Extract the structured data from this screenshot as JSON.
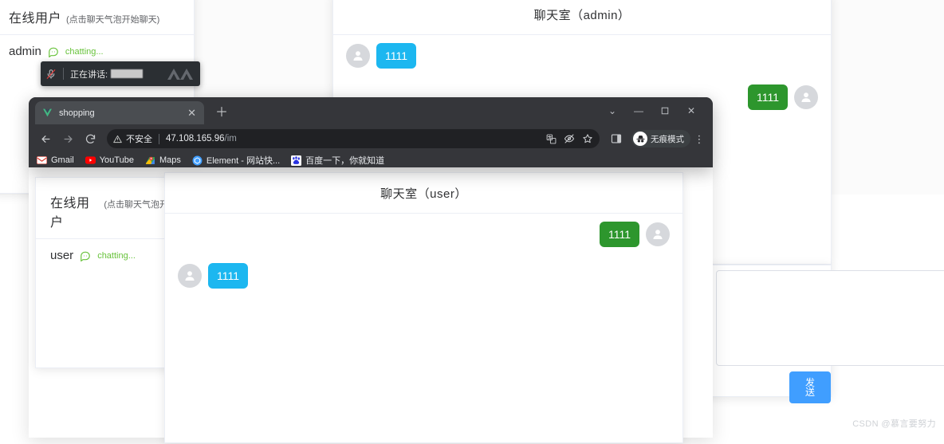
{
  "background_app": {
    "online_panel": {
      "title": "在线用户",
      "hint": "(点击聊天气泡开始聊天)",
      "user": "admin",
      "status": "chatting...",
      "chat_icon": "chat-bubble-icon"
    },
    "chatroom": {
      "title": "聊天室（admin）",
      "messages": [
        {
          "side": "left",
          "text": "1111",
          "color": "#1cb7f0",
          "avatar": "user-avatar-icon"
        },
        {
          "side": "right",
          "text": "1111",
          "color": "#2d962d",
          "avatar": "user-avatar-icon"
        }
      ]
    },
    "composer": {
      "send_label": "发送",
      "textarea_value": "",
      "resize_handle": "resize-grip-icon"
    }
  },
  "speaking_toast": {
    "mic_icon": "microphone-muted-icon",
    "label": "正在讲话:",
    "redacted_value": "",
    "brand_icon": "chevrons-logo-icon"
  },
  "browser": {
    "tab": {
      "title": "shopping",
      "favicon": "vue-logo-icon",
      "close_icon": "close-icon"
    },
    "new_tab_icon": "plus-icon",
    "window_controls": {
      "chevron": "chevron-down-icon",
      "minimize": "minimize-icon",
      "maximize": "maximize-icon",
      "close": "close-icon"
    },
    "nav": {
      "back_icon": "arrow-left-icon",
      "forward_icon": "arrow-right-icon",
      "reload_icon": "reload-icon"
    },
    "omnibox": {
      "warning_icon": "warning-triangle-icon",
      "warning_text": "不安全",
      "url_host": "47.108.165.96",
      "url_path": "/im",
      "actions": [
        {
          "name": "translate-icon",
          "glyph": "translate"
        },
        {
          "name": "eye-off-icon",
          "glyph": "eye-off"
        },
        {
          "name": "bookmark-star-icon",
          "glyph": "star"
        }
      ]
    },
    "side_panel_icon": "side-panel-icon",
    "incognito": {
      "label": "无痕模式",
      "icon": "incognito-hat-icon"
    },
    "menu_icon": "kebab-menu-icon",
    "bookmarks": [
      {
        "label": "Gmail",
        "icon": "gmail-icon",
        "color": "#d93025"
      },
      {
        "label": "YouTube",
        "icon": "youtube-icon",
        "color": "#ff0000"
      },
      {
        "label": "Maps",
        "icon": "google-maps-icon",
        "color": "#34a853"
      },
      {
        "label": "Element - 网站快...",
        "icon": "element-ui-icon",
        "color": "#409eff"
      },
      {
        "label": "百度一下，你就知道",
        "icon": "baidu-icon",
        "color": "#2932e1"
      }
    ]
  },
  "foreground_app": {
    "online_panel": {
      "title": "在线用户",
      "hint": "(点击聊天气泡开始聊",
      "user": "user",
      "status": "chatting...",
      "chat_icon": "chat-bubble-icon"
    },
    "chatroom": {
      "title": "聊天室（user）",
      "messages": [
        {
          "side": "right",
          "text": "1111",
          "color": "#2d962d",
          "avatar": "user-avatar-icon"
        },
        {
          "side": "left",
          "text": "1111",
          "color": "#1cb7f0",
          "avatar": "user-avatar-icon"
        }
      ]
    }
  },
  "watermark": "CSDN @慕言要努力",
  "theme": {
    "blue_bubble": "#1cb7f0",
    "green_bubble": "#2d962d",
    "primary_button": "#409eff",
    "status_green": "#67c23a",
    "chrome_dark": "#35363a",
    "omnibox_dark": "#202124",
    "border": "#ebeef5"
  }
}
